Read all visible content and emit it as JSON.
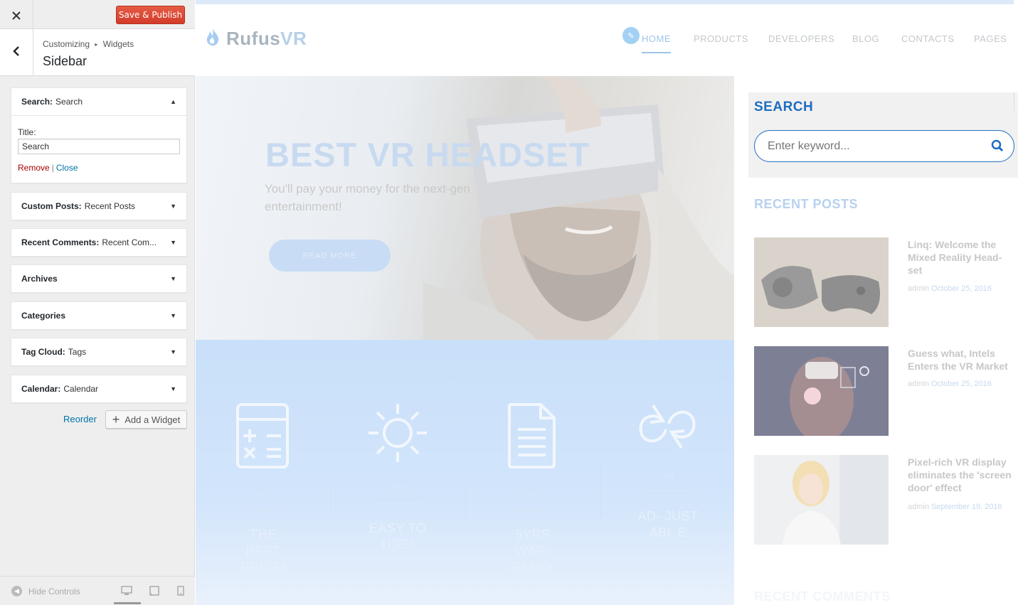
{
  "customizer": {
    "close_icon": "close-icon",
    "publish_label": "Save & Publish",
    "breadcrumb": {
      "root": "Customizing",
      "separator": "▸",
      "parent": "Widgets"
    },
    "section_title": "Sidebar",
    "widgets": [
      {
        "name": "Search:",
        "sub": "Search"
      },
      {
        "name": "Custom Posts:",
        "sub": "Recent Posts"
      },
      {
        "name": "Recent Comments:",
        "sub": "Recent Com..."
      },
      {
        "name": "Archives",
        "sub": ""
      },
      {
        "name": "Categories",
        "sub": ""
      },
      {
        "name": "Tag Cloud:",
        "sub": "Tags"
      },
      {
        "name": "Calendar:",
        "sub": "Calendar"
      }
    ],
    "search_widget": {
      "title_label": "Title:",
      "title_value": "Search",
      "remove_label": "Remove",
      "separator": "|",
      "close_label": "Close"
    },
    "reorder_label": "Reorder",
    "add_widget_label": "Add a Widget",
    "hide_controls_label": "Hide Controls",
    "colors": {
      "publish": "#d43b2a",
      "link": "#0073aa",
      "remove": "#aa0000"
    }
  },
  "preview": {
    "logo": {
      "prefix": "Rufus",
      "suffix": "VR"
    },
    "nav": [
      "HOME",
      "PRODUCTS",
      "DEVELOPERS",
      "BLOG",
      "CONTACTS",
      "PAGES"
    ],
    "hero": {
      "title": "BEST VR HEADSET",
      "subtitle": "You'll pay your money for the next-gen entertainment!",
      "button": "READ MORE"
    },
    "features": [
      {
        "icon": "calculator-icon",
        "num": "001",
        "label": "THE BEST PRICE!"
      },
      {
        "icon": "sun-icon",
        "num": "002",
        "label": "EASY TO USE!"
      },
      {
        "icon": "document-icon",
        "num": "003",
        "label": "5YRS WAR- RANTY"
      },
      {
        "icon": "refresh-icon",
        "num": "004",
        "label": "AD- JUSTABL E"
      }
    ],
    "sidebar": {
      "search_title": "SEARCH",
      "search_placeholder": "Enter keyword...",
      "recent_posts_title": "RECENT POSTS",
      "posts": [
        {
          "title": "Linq: Welcome the Mixed Reality Head-set",
          "author": "admin",
          "date": "October 25, 2016"
        },
        {
          "title": "Guess what, Intels Enters the VR Market",
          "author": "admin",
          "date": "October 25, 2016"
        },
        {
          "title": "Pixel-rich VR display eliminates the 'screen door' effect",
          "author": "admin",
          "date": "September 19, 2016"
        }
      ],
      "recent_comments_title": "RECENT COMMENTS"
    },
    "colors": {
      "accent": "#1e6dc0",
      "hero_title": "#c8daf0",
      "feature_bg": "#c9e0fa"
    }
  }
}
